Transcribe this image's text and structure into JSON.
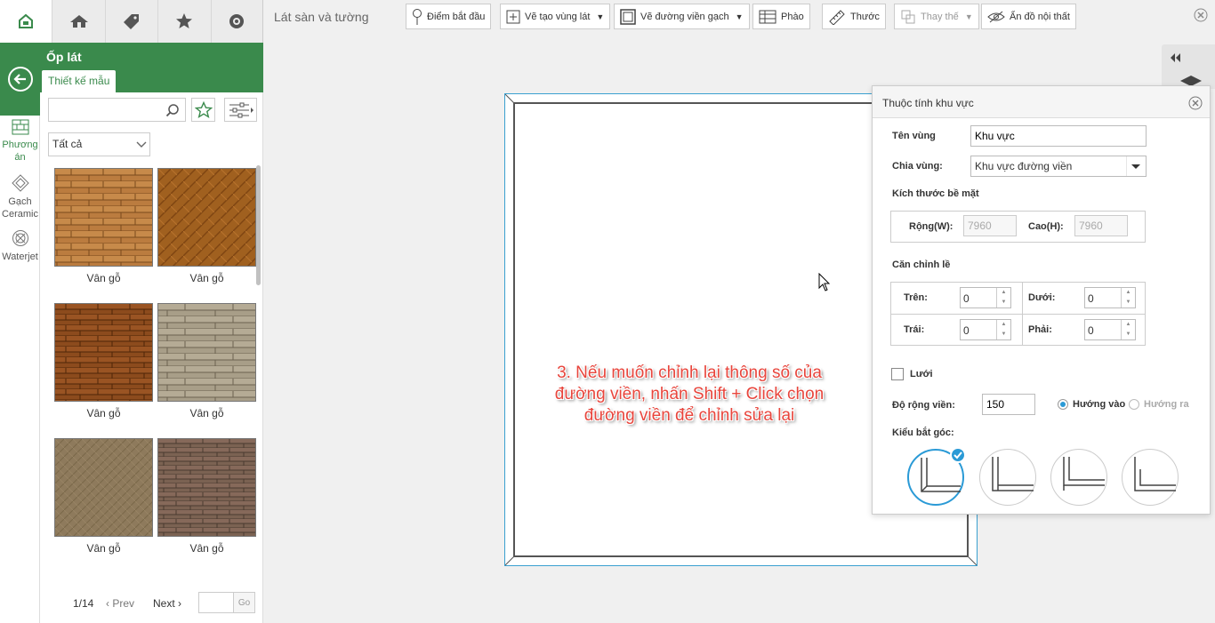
{
  "top_tabs": [
    {
      "icon": "home-logo-icon"
    },
    {
      "icon": "house-roof-icon"
    },
    {
      "icon": "tag-icon"
    },
    {
      "icon": "star-icon"
    },
    {
      "icon": "compass-icon"
    }
  ],
  "left_nav": {
    "items": [
      {
        "label": "Phương án",
        "icon": "floor-grid-icon"
      },
      {
        "label": "Gạch Ceramic",
        "icon": "diamond-tile-icon"
      },
      {
        "label": "Waterjet",
        "icon": "waterjet-icon"
      }
    ]
  },
  "panel": {
    "title": "Ốp lát",
    "tab": "Thiết kế mẫu",
    "search_placeholder": "",
    "category": "Tất cả",
    "tiles": [
      {
        "label": "Vân gỗ",
        "color": "#b87a3d"
      },
      {
        "label": "Vân gỗ",
        "color": "#9b5a22"
      },
      {
        "label": "Vân gỗ",
        "color": "#8a4a1e"
      },
      {
        "label": "Vân gỗ",
        "color": "#a49a85"
      },
      {
        "label": "Vân gỗ",
        "color": "#8c7759"
      },
      {
        "label": "Vân gỗ",
        "color": "#7a6250"
      }
    ],
    "pager": {
      "info": "1/14",
      "prev": "Prev",
      "next": "Next",
      "go": "Go",
      "page_value": ""
    }
  },
  "toolbar": {
    "title": "Lát sàn và tường",
    "buttons": [
      {
        "label": "Điểm bắt đầu",
        "icon": "pin-icon"
      },
      {
        "label": "Vẽ tạo vùng lát",
        "icon": "add-area-icon",
        "dropdown": true
      },
      {
        "label": "Vẽ đường viền gạch",
        "icon": "border-icon",
        "dropdown": true
      },
      {
        "label": "Phào",
        "icon": "molding-icon"
      },
      {
        "label": "Thước",
        "icon": "ruler-icon"
      },
      {
        "label": "Thay thế",
        "icon": "replace-icon",
        "dropdown": true,
        "disabled": true
      },
      {
        "label": "Ẩn đồ nội thất",
        "icon": "hide-furniture-icon"
      }
    ]
  },
  "canvas": {
    "caption": "3. Nếu muốn chỉnh lại thông số của đường viền, nhấn Shift + Click chọn đường viền để chỉnh sửa lại"
  },
  "props": {
    "title": "Thuộc tính khu vực",
    "name_label": "Tên vùng",
    "name_value": "Khu vực",
    "split_label": "Chia vùng:",
    "split_value": "Khu vực đường viền",
    "surface_label": "Kích thước bề mặt",
    "width_label": "Rộng(W):",
    "width_value": "7960",
    "height_label": "Cao(H):",
    "height_value": "7960",
    "align_label": "Căn chỉnh lề",
    "top_label": "Trên:",
    "top_value": "0",
    "bottom_label": "Dưới:",
    "bottom_value": "0",
    "left_label": "Trái:",
    "left_value": "0",
    "right_label": "Phải:",
    "right_value": "0",
    "grid_label": "Lưới",
    "border_width_label": "Độ rộng viền:",
    "border_width_value": "150",
    "dir_in": "Hướng vào",
    "dir_out": "Hướng ra",
    "corner_label": "Kiểu bắt góc:"
  },
  "colors": {
    "brand_green": "#3a8a4c",
    "accent_blue": "#2a9ad6",
    "caption_red": "#e8453c"
  }
}
